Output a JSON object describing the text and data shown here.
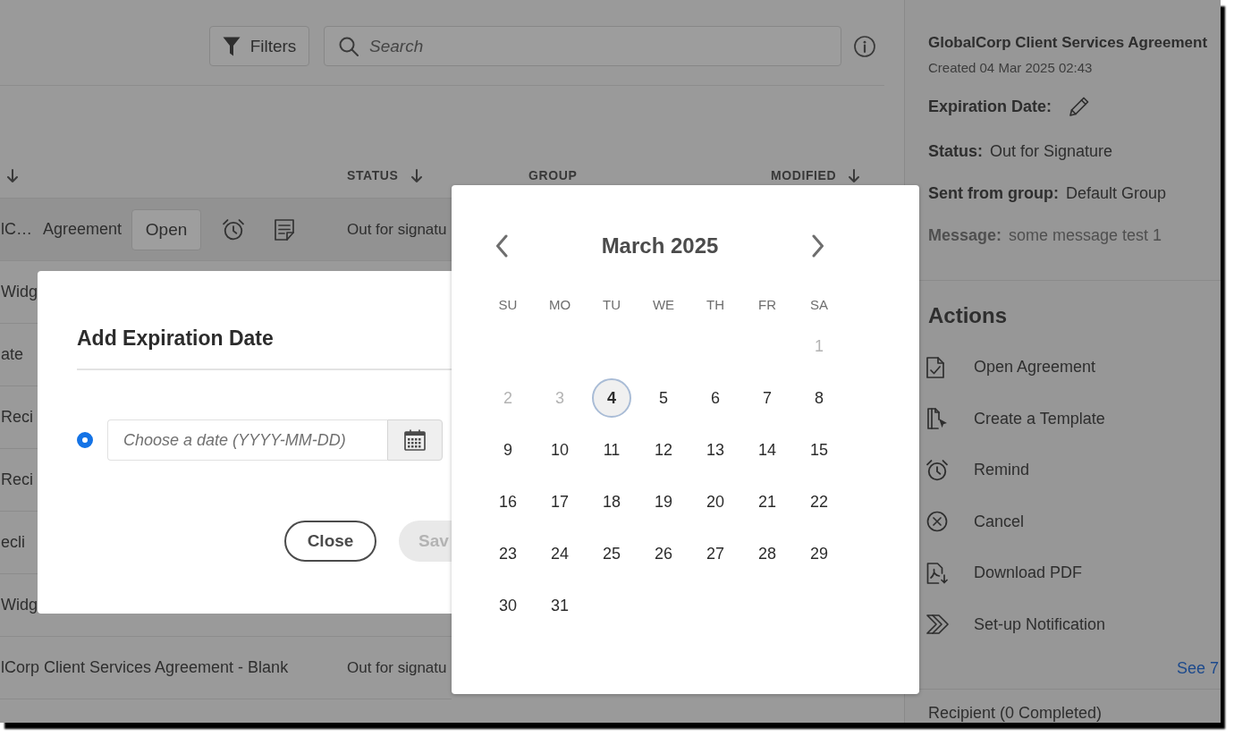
{
  "toolbar": {
    "filters_button": "Filters",
    "search": {
      "placeholder": "Search"
    }
  },
  "table": {
    "columns": [
      {
        "sortable": true
      },
      {
        "label": "STATUS",
        "sortable": true
      },
      {
        "label": "GROUP",
        "sortable": false
      },
      {
        "label": "MODIFIED",
        "sortable": true
      }
    ],
    "rows": [
      {
        "name": "lC…",
        "type": "Agreement",
        "open_button": "Open",
        "status": "Out for signatu",
        "selected": true
      },
      {
        "name": "Widg",
        "selected": false
      },
      {
        "name": "ate",
        "selected": false
      },
      {
        "name": "Reci",
        "selected": false
      },
      {
        "name": "Reci",
        "selected": false
      },
      {
        "name": "ecli",
        "selected": false
      },
      {
        "name": "Widg",
        "selected": false
      },
      {
        "name": "lCorp Client Services Agreement - Blank",
        "status": "Out for signatu",
        "selected": false
      }
    ]
  },
  "dialog": {
    "title": "Add Expiration Date",
    "date_option": {
      "selected": true,
      "placeholder": "Choose a date (YYYY-MM-DD)"
    },
    "buttons": [
      {
        "label": "Close",
        "disabled": false
      },
      {
        "label": "Sav",
        "disabled": true
      }
    ]
  },
  "date_picker": {
    "title": "March 2025",
    "weekdays": [
      "SU",
      "MO",
      "TU",
      "WE",
      "TH",
      "FR",
      "SA"
    ],
    "weeks": [
      [
        {
          "label": "1",
          "disabled": true,
          "today": false
        }
      ],
      [
        {
          "label": "2",
          "disabled": true,
          "today": false
        },
        {
          "label": "3",
          "disabled": true,
          "today": false
        },
        {
          "label": "4",
          "disabled": false,
          "today": true
        },
        {
          "label": "5",
          "disabled": false,
          "today": false
        },
        {
          "label": "6",
          "disabled": false,
          "today": false
        },
        {
          "label": "7",
          "disabled": false,
          "today": false
        },
        {
          "label": "8",
          "disabled": false,
          "today": false
        }
      ],
      [
        {
          "label": "9",
          "disabled": false,
          "today": false
        },
        {
          "label": "10",
          "disabled": false,
          "today": false
        },
        {
          "label": "11",
          "disabled": false,
          "today": false
        },
        {
          "label": "12",
          "disabled": false,
          "today": false
        },
        {
          "label": "13",
          "disabled": false,
          "today": false
        },
        {
          "label": "14",
          "disabled": false,
          "today": false
        },
        {
          "label": "15",
          "disabled": false,
          "today": false
        }
      ],
      [
        {
          "label": "16",
          "disabled": false,
          "today": false
        },
        {
          "label": "17",
          "disabled": false,
          "today": false
        },
        {
          "label": "18",
          "disabled": false,
          "today": false
        },
        {
          "label": "19",
          "disabled": false,
          "today": false
        },
        {
          "label": "20",
          "disabled": false,
          "today": false
        },
        {
          "label": "21",
          "disabled": false,
          "today": false
        },
        {
          "label": "22",
          "disabled": false,
          "today": false
        }
      ],
      [
        {
          "label": "23",
          "disabled": false,
          "today": false
        },
        {
          "label": "24",
          "disabled": false,
          "today": false
        },
        {
          "label": "25",
          "disabled": false,
          "today": false
        },
        {
          "label": "26",
          "disabled": false,
          "today": false
        },
        {
          "label": "27",
          "disabled": false,
          "today": false
        },
        {
          "label": "28",
          "disabled": false,
          "today": false
        },
        {
          "label": "29",
          "disabled": false,
          "today": false
        }
      ],
      [
        {
          "label": "30",
          "disabled": false,
          "today": false
        },
        {
          "label": "31",
          "disabled": false,
          "today": false
        }
      ]
    ]
  },
  "details": {
    "title": "GlobalCorp Client Services Agreement",
    "created": "Created 04 Mar 2025 02:43",
    "expiration_label": "Expiration Date:",
    "fields": [
      {
        "label": "Status:",
        "value": "Out for Signature",
        "muted": false
      },
      {
        "label": "Sent from group:",
        "value": "Default Group",
        "muted": false
      },
      {
        "label": "Message:",
        "value": "some message test 1",
        "muted": true
      }
    ],
    "actions_heading": "Actions",
    "actions": [
      "Open Agreement",
      "Create a Template",
      "Remind",
      "Cancel",
      "Download PDF",
      "Set-up Notification"
    ],
    "more_link": "See 7",
    "recipients_heading": "Recipient (0 Completed)"
  }
}
